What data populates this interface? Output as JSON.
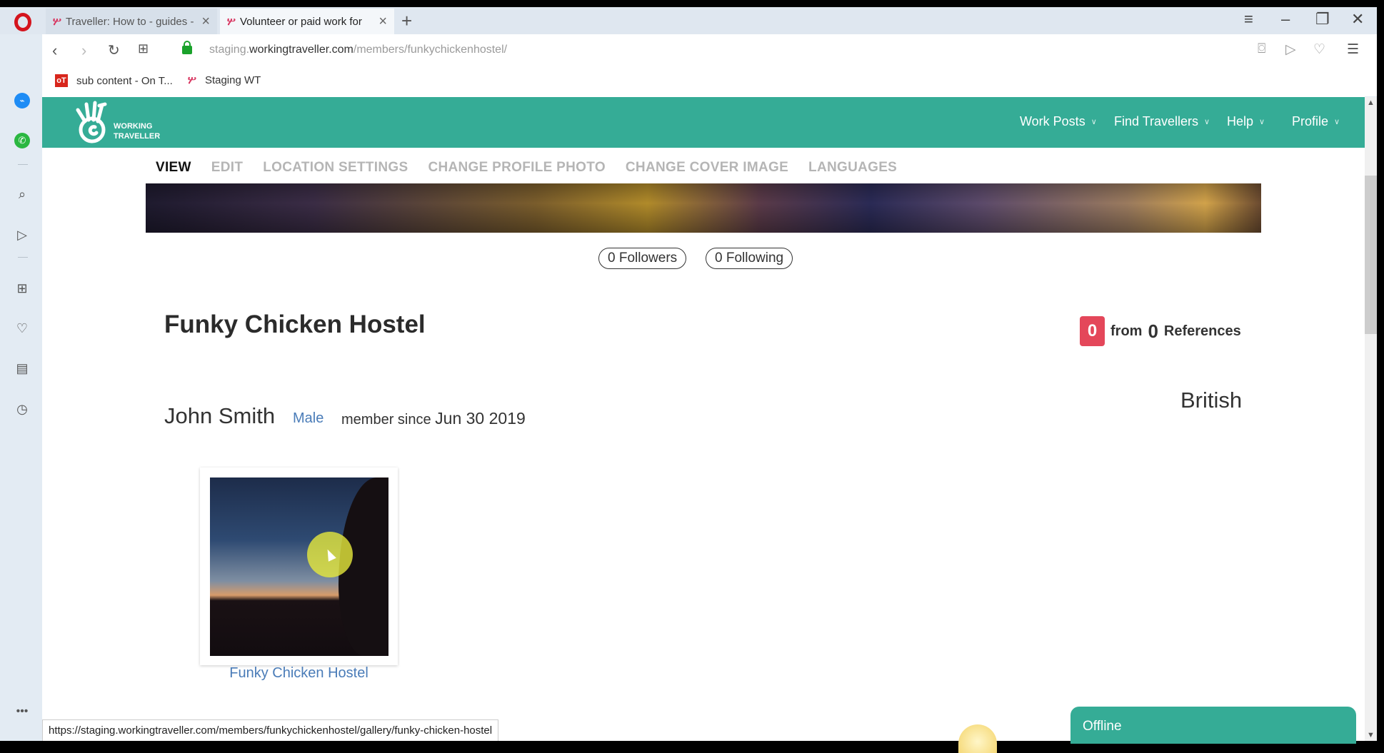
{
  "browser": {
    "tabs": [
      {
        "title": "Traveller: How to - guides -",
        "active": false
      },
      {
        "title": "Volunteer or paid work for",
        "active": true
      }
    ],
    "address": {
      "prefix": "staging.",
      "domain": "workingtraveller.com",
      "path": "/members/funkychickenhostel/"
    },
    "bookmarks": [
      {
        "label": "sub content - On T...",
        "icon": "ot-icon"
      },
      {
        "label": "Staging WT",
        "icon": "wt-icon"
      }
    ],
    "status_url": "https://staging.workingtraveller.com/members/funkychickenhostel/gallery/funky-chicken-hostel"
  },
  "site": {
    "logo": {
      "line1": "WORKING",
      "line2": "TRAVELLER"
    },
    "menu": [
      "Work Posts",
      "Find Travellers",
      "Help",
      "Profile"
    ],
    "brand_color": "#35ac96"
  },
  "profile": {
    "subnav": [
      "VIEW",
      "EDIT",
      "LOCATION SETTINGS",
      "CHANGE PROFILE PHOTO",
      "CHANGE COVER IMAGE",
      "LANGUAGES"
    ],
    "active_subnav": "VIEW",
    "followers": "0 Followers",
    "following": "0 Following",
    "title": "Funky Chicken Hostel",
    "references": {
      "score": "0",
      "from_label": "from",
      "count": "0",
      "label": "References",
      "badge_color": "#e4475a"
    },
    "name": "John Smith",
    "gender": "Male",
    "member_since_label": "member since",
    "member_since_date": "Jun 30 2019",
    "nationality": "British",
    "gallery": [
      {
        "caption": "Funky Chicken Hostel"
      }
    ]
  },
  "chat": {
    "status": "Offline"
  }
}
